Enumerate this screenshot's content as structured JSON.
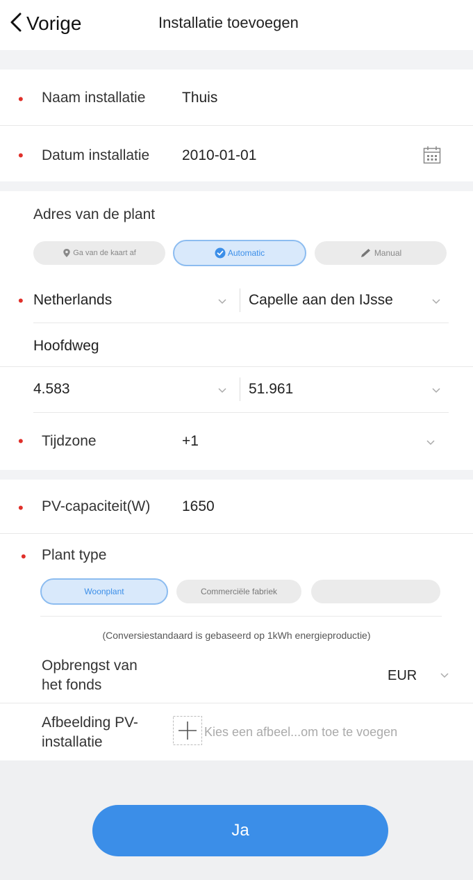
{
  "header": {
    "back_label": "Vorige",
    "title": "Installatie toevoegen"
  },
  "form": {
    "name": {
      "label": "Naam installatie",
      "value": "Thuis"
    },
    "date": {
      "label": "Datum installatie",
      "value": "2010-01-01",
      "icon": "calendar-icon"
    },
    "address": {
      "heading": "Adres van de plant",
      "modes": [
        {
          "label": "Ga van de kaart af",
          "icon": "map-pin-icon",
          "active": false
        },
        {
          "label": "Automatic",
          "icon": "check-circle-icon",
          "active": true
        },
        {
          "label": "Manual",
          "icon": "pencil-icon",
          "active": false
        }
      ],
      "country": "Netherlands",
      "city": "Capelle aan den IJsse",
      "street": "Hoofdweg",
      "longitude": "4.583",
      "latitude": "51.961"
    },
    "timezone": {
      "label": "Tijdzone",
      "value": "+1"
    },
    "pv_capacity": {
      "label": "PV-capaciteit(W)",
      "value": "1650"
    },
    "plant_type": {
      "label": "Plant type",
      "options": [
        {
          "label": "Woonplant",
          "active": true
        },
        {
          "label": "Commerciële fabriek",
          "active": false
        },
        {
          "label": "",
          "active": false
        }
      ]
    },
    "conversion_note": "(Conversiestandaard is gebaseerd op 1kWh energieproductie)",
    "fund": {
      "label_line1": "Opbrengst van",
      "label_line2": "het fonds",
      "currency": "EUR"
    },
    "image": {
      "label_line1": "Afbeelding PV-",
      "label_line2": "installatie",
      "placeholder": "Kies een afbeel...om toe te voegen",
      "icon": "plus-icon"
    }
  },
  "submit_label": "Ja",
  "colors": {
    "accent": "#3b8ee8",
    "required": "#e0302a",
    "background_gray": "#f2f3f5"
  }
}
